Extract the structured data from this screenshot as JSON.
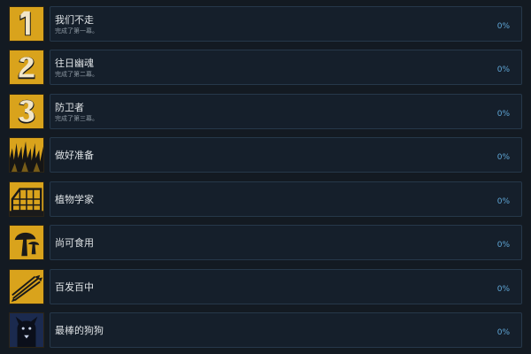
{
  "achievements": [
    {
      "title": "我们不走",
      "description": "完成了第一幕。",
      "percent": "0%",
      "icon": "number-1-icon"
    },
    {
      "title": "往日幽魂",
      "description": "完成了第二幕。",
      "percent": "0%",
      "icon": "number-2-icon"
    },
    {
      "title": "防卫者",
      "description": "完成了第三幕。",
      "percent": "0%",
      "icon": "number-3-icon"
    },
    {
      "title": "做好准备",
      "description": "",
      "percent": "0%",
      "icon": "grass-icon"
    },
    {
      "title": "植物学家",
      "description": "",
      "percent": "0%",
      "icon": "greenhouse-icon"
    },
    {
      "title": "尚可食用",
      "description": "",
      "percent": "0%",
      "icon": "mushroom-icon"
    },
    {
      "title": "百发百中",
      "description": "",
      "percent": "0%",
      "icon": "arrows-icon"
    },
    {
      "title": "最棒的狗狗",
      "description": "",
      "percent": "0%",
      "icon": "dog-icon"
    }
  ],
  "colors": {
    "background": "#131a22",
    "card": "#151f2b",
    "card_border": "#26384a",
    "icon_gold": "#d9a31c",
    "percent_blue": "#5fa6d6"
  }
}
